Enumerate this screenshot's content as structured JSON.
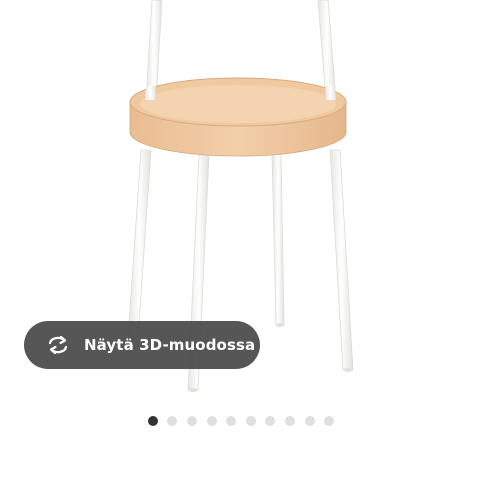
{
  "view_3d": {
    "label": "Näytä 3D-muodossa",
    "icon": "rotate-3d-icon"
  },
  "carousel": {
    "dot_count": 10,
    "active_index": 0
  },
  "colors": {
    "button_background": "#484848",
    "button_text": "#ffffff",
    "dot_active": "#333333",
    "dot_inactive": "#dfdfdf",
    "tabletop_wood": "#f0c9a1",
    "legs": "#fafaf8"
  }
}
